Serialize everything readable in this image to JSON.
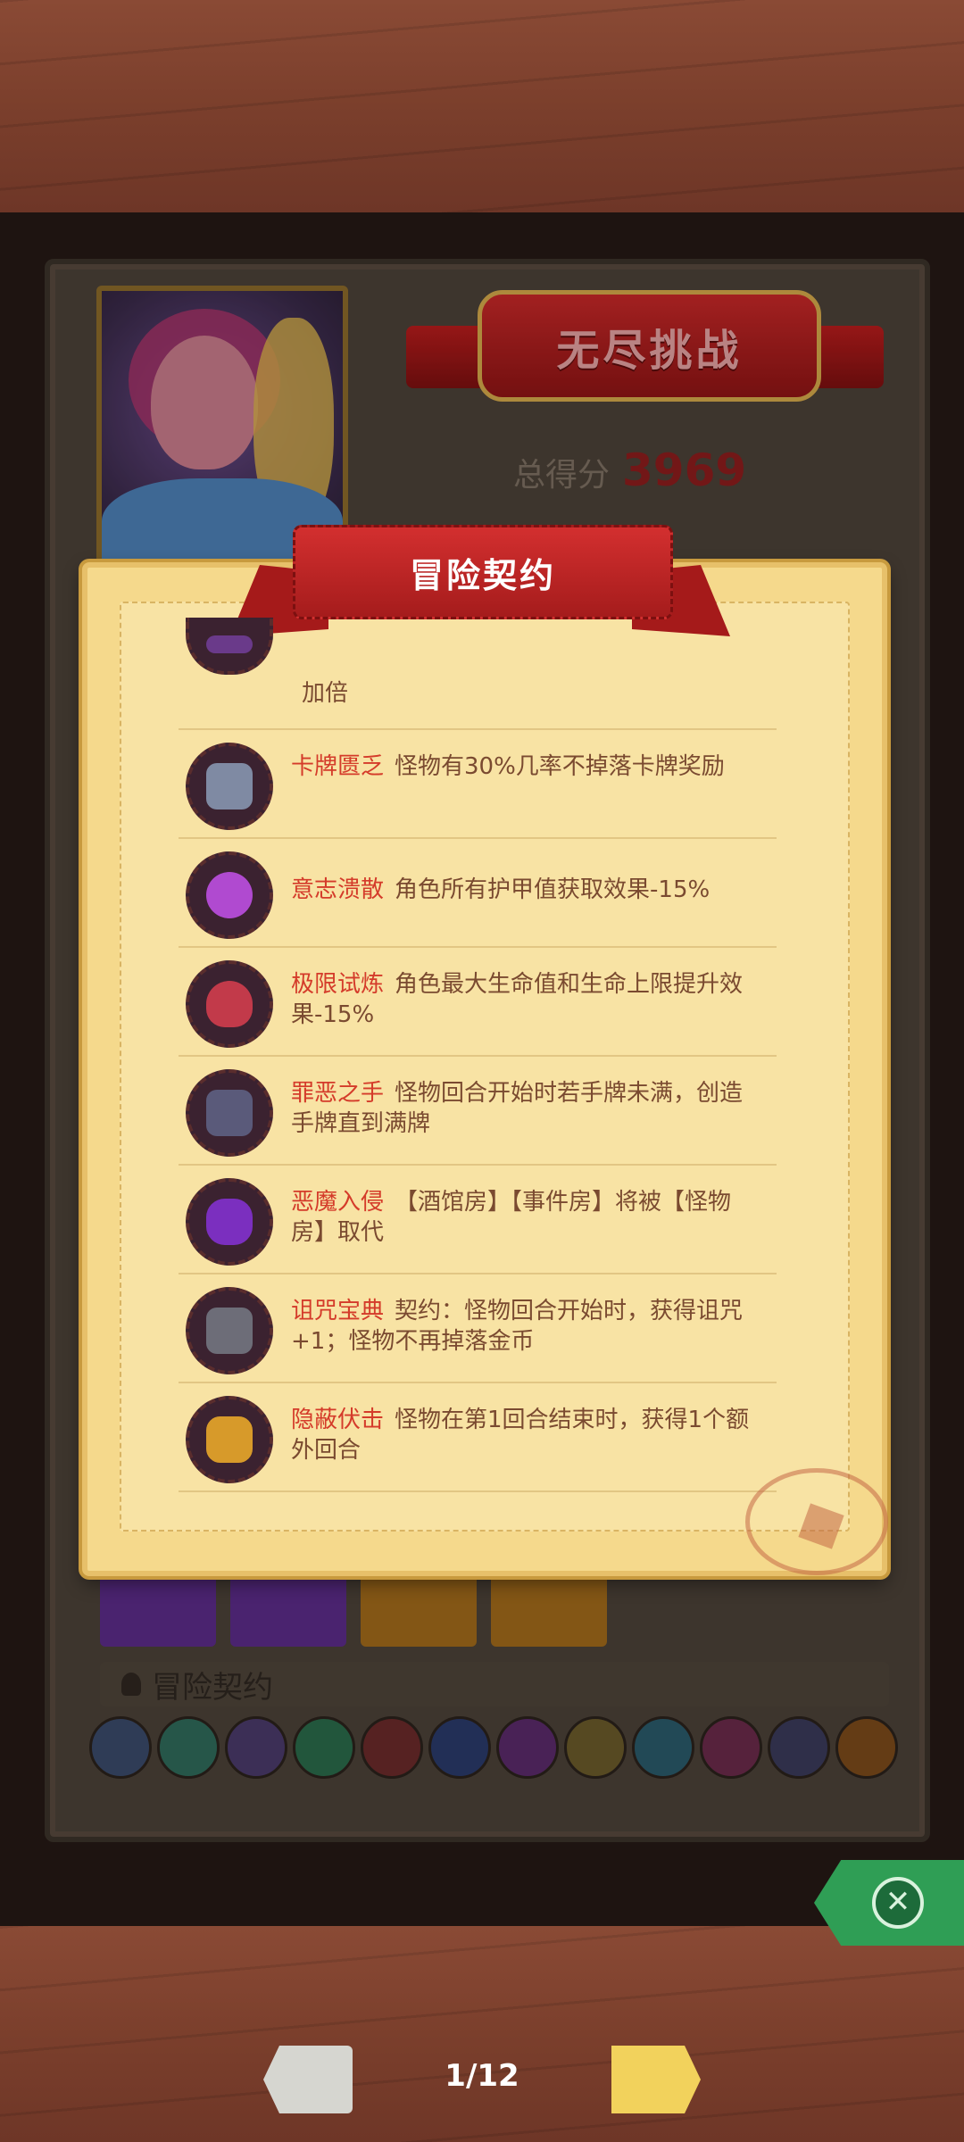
{
  "background_card": {
    "title": "无尽挑战",
    "score_label": "总得分",
    "score_value": "3969",
    "contract_section_label": "冒险契约"
  },
  "modal": {
    "title": "冒险契约",
    "items": [
      {
        "name": "",
        "desc": "加倍",
        "icon": "partial-emblem-icon",
        "color": "#6a3a8a"
      },
      {
        "name": "卡牌匮乏",
        "desc": "怪物有30%几率不掉落卡牌奖励",
        "icon": "card-scarcity-icon",
        "color": "#7f8aa3"
      },
      {
        "name": "意志溃散",
        "desc": "角色所有护甲值获取效果-15%",
        "icon": "shield-break-icon",
        "color": "#b04ad0"
      },
      {
        "name": "极限试炼",
        "desc": "角色最大生命值和生命上限提升效果-15%",
        "icon": "heart-lock-icon",
        "color": "#c23a4a"
      },
      {
        "name": "罪恶之手",
        "desc": "怪物回合开始时若手牌未满，创造手牌直到满牌",
        "icon": "evil-hand-icon",
        "color": "#5a5a7a"
      },
      {
        "name": "恶魔入侵",
        "desc": "【酒馆房】【事件房】将被【怪物房】取代",
        "icon": "demon-icon",
        "color": "#7b2fbf"
      },
      {
        "name": "诅咒宝典",
        "desc": "契约：怪物回合开始时，获得诅咒+1；怪物不再掉落金币",
        "icon": "skull-tome-icon",
        "color": "#6d6d78"
      },
      {
        "name": "隐蔽伏击",
        "desc": "怪物在第1回合结束时，获得1个额外回合",
        "icon": "ambush-star-icon",
        "color": "#d79a2a"
      }
    ]
  },
  "pager": {
    "page": "1/12"
  },
  "colors": {
    "accent_red": "#d43b2a",
    "close_green": "#2f9e55",
    "next_yellow": "#f2d25c"
  }
}
